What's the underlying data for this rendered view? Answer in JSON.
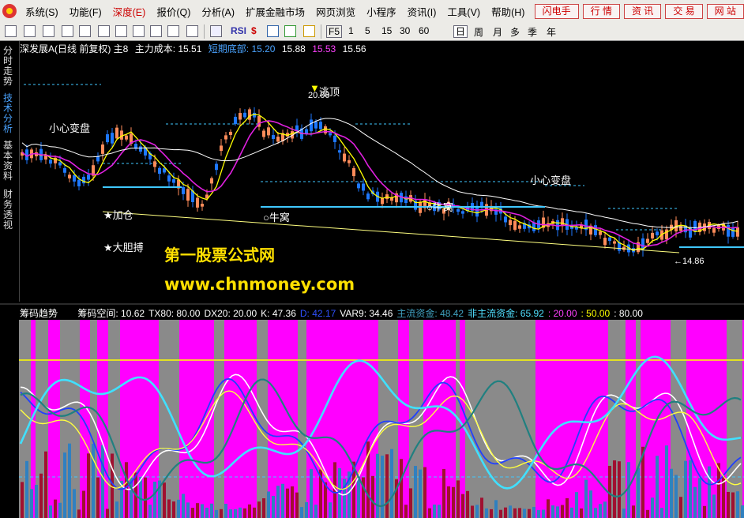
{
  "menubar": {
    "items": [
      "系统(S)",
      "功能(F)",
      "深度(E)",
      "报价(Q)",
      "分析(A)",
      "扩展金融市场",
      "网页浏览",
      "小程序",
      "资讯(I)",
      "工具(V)",
      "帮助(H)"
    ],
    "quick": [
      "闪电手",
      "行 情",
      "资 讯",
      "交 易",
      "网 站"
    ]
  },
  "toolbar": {
    "periods": [
      "F5",
      "1",
      "5",
      "15",
      "30",
      "60",
      "日",
      "周",
      "月",
      "多",
      "季",
      "年"
    ]
  },
  "sidetabs": [
    "分时走势",
    "技术分析",
    "基本资料",
    "财务透视"
  ],
  "price_panel": {
    "stock": "深发展A(日线 前复权) 主8",
    "cost_label": "主力成本:",
    "cost_value": "15.51",
    "short_label": "短期底部:",
    "values": [
      "15.20",
      "15.88",
      "15.53",
      "15.56"
    ]
  },
  "annotations": {
    "xinxin1": "小心变盘",
    "xinxin2": "小心变盘",
    "taotop": "逃顶",
    "high": "20.00",
    "jiacang": "★加仓",
    "dadan": "★大胆搏",
    "niuwo1": "○牛窝",
    "niuwo2": "○牛窝",
    "low": "←14.86",
    "watermark1": "第一股票公式网",
    "watermark2": "www.chnmoney.com"
  },
  "indicator_panel": {
    "name": "筹码趋势",
    "items": [
      {
        "t": "筹码空间: 10.62",
        "c": "#ffffff"
      },
      {
        "t": "TX80: 80.00",
        "c": "#ffffff"
      },
      {
        "t": "DX20: 20.00",
        "c": "#ffffff"
      },
      {
        "t": "K: 47.36",
        "c": "#ffffff"
      },
      {
        "t": "D: 42.17",
        "c": "#3050ff"
      },
      {
        "t": "VAR9: 34.46",
        "c": "#ffffff"
      },
      {
        "t": "主流资金: 48.42",
        "c": "#40a0c0"
      },
      {
        "t": "非主流资金: 65.92",
        "c": "#50e0ff"
      },
      {
        "t": ": 20.00",
        "c": "#ff40ff"
      },
      {
        "t": ": 50.00",
        "c": "#ffff00"
      },
      {
        "t": ": 80.00",
        "c": "#ffffff"
      }
    ]
  },
  "colors": {
    "up": "#ff8c5a",
    "down": "#1e78ff",
    "ma_short": "#ffff00",
    "ma_mid": "#e020e0",
    "ma_long": "#ffffff",
    "bg": "#000000"
  }
}
